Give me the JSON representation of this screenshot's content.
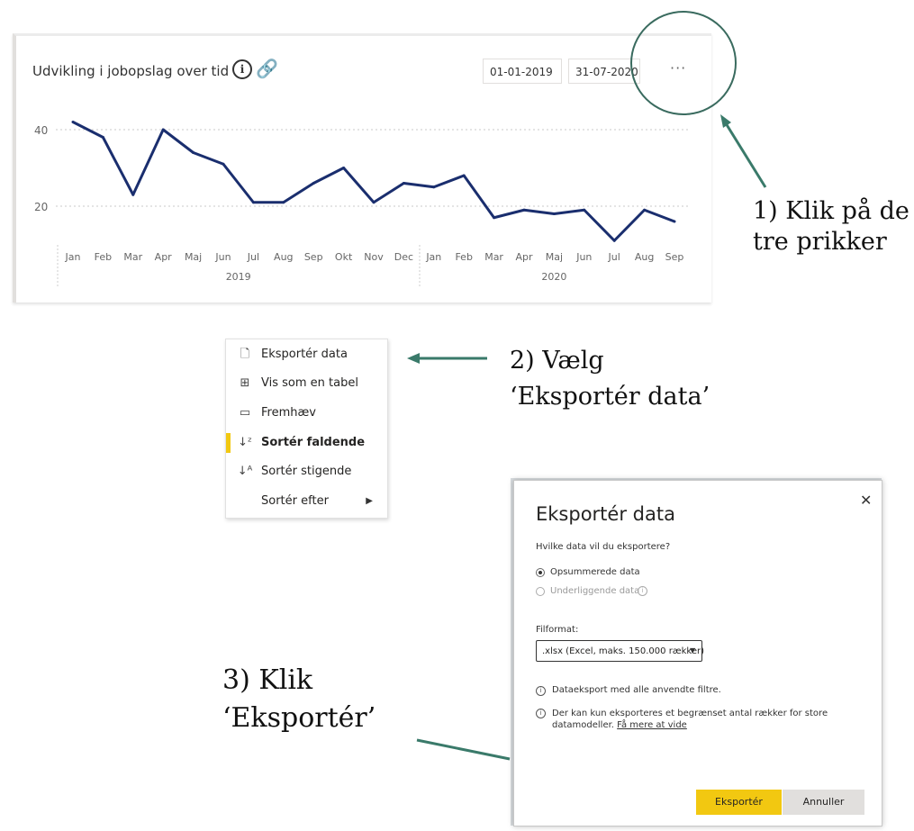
{
  "card": {
    "title": "Udvikling i jobopslag over tid",
    "date_from": "01-01-2019",
    "date_to": "31-07-2020",
    "more": "···"
  },
  "chart_data": {
    "type": "line",
    "series": [
      {
        "values": [
          42,
          38,
          23,
          40,
          34,
          31,
          21,
          21,
          26,
          30,
          21,
          26,
          25,
          28,
          17,
          19,
          18,
          19,
          11,
          19,
          16
        ]
      }
    ],
    "categories": [
      "Jan",
      "Feb",
      "Mar",
      "Apr",
      "Maj",
      "Jun",
      "Jul",
      "Aug",
      "Sep",
      "Okt",
      "Nov",
      "Dec",
      "Jan",
      "Feb",
      "Mar",
      "Apr",
      "Maj",
      "Jun",
      "Jul",
      "Aug",
      "Sep"
    ],
    "groups": [
      "2019",
      "2020"
    ],
    "y_ticks": [
      "20",
      "40"
    ],
    "ylim": [
      0,
      50
    ],
    "color": "#1a2e6e",
    "grid": true
  },
  "annotations": {
    "step1_line1": "1) Klik på de",
    "step1_line2": "tre prikker",
    "step2_line1": "2) Vælg",
    "step2_line2": "‘Eksportér data’",
    "step3_line1": "3) Klik",
    "step3_line2": "‘Eksportér’",
    "arrow_color": "#3a7a6a"
  },
  "menu": {
    "items": [
      {
        "icon": "export-icon",
        "label": "Eksportér data"
      },
      {
        "icon": "table-icon",
        "label": "Vis som en tabel"
      },
      {
        "icon": "spotlight-icon",
        "label": "Fremhæv"
      },
      {
        "icon": "sort-desc-icon",
        "label": "Sortér faldende"
      },
      {
        "icon": "sort-asc-icon",
        "label": "Sortér stigende"
      },
      {
        "icon": "",
        "label": "Sortér efter"
      }
    ],
    "accent": "#f2c811"
  },
  "dialog": {
    "title": "Eksportér data",
    "question": "Hvilke data vil du eksportere?",
    "option1": "Opsummerede data",
    "option2": "Underliggende data",
    "format_label": "Filformat:",
    "format_value": ".xlsx (Excel, maks. 150.000 rækker)",
    "note1": "Dataeksport med alle anvendte filtre.",
    "note2": "Der kan kun eksporteres et begrænset antal rækker for store datamodeller.",
    "note2_link": "Få mere at vide",
    "export_button": "Eksportér",
    "cancel_button": "Annuller",
    "accent": "#f2c811"
  }
}
